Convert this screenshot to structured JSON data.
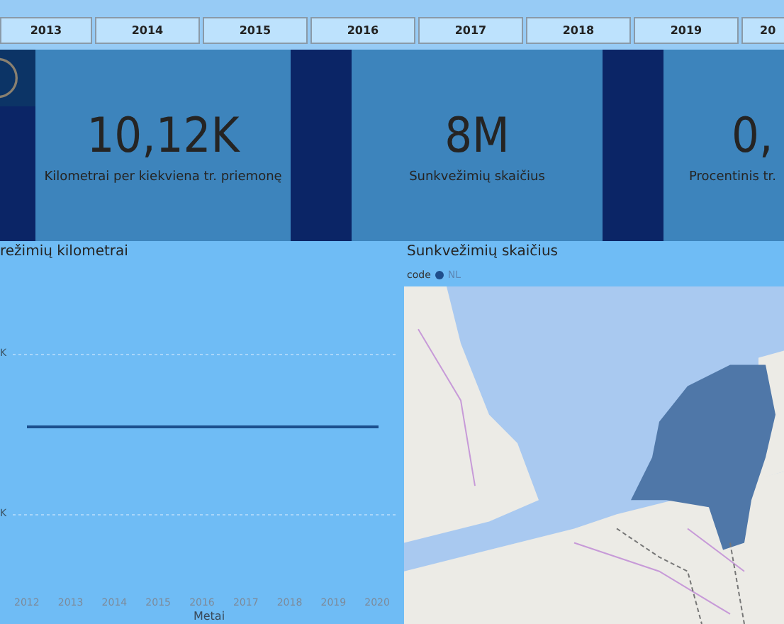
{
  "year_slicer": [
    {
      "label": "2013",
      "selected": false
    },
    {
      "label": "2014",
      "selected": false
    },
    {
      "label": "2015",
      "selected": false
    },
    {
      "label": "2016",
      "selected": false
    },
    {
      "label": "2017",
      "selected": false
    },
    {
      "label": "2018",
      "selected": false
    },
    {
      "label": "2019",
      "selected": false
    },
    {
      "label": "20",
      "selected": false
    }
  ],
  "cards": [
    {
      "value": "10,12K",
      "label": "Kilometrai per kiekviena tr. priemonę"
    },
    {
      "value": "8M",
      "label": "Sunkvežimių skaičius"
    },
    {
      "value": "0,",
      "label": "Procentinis tr."
    }
  ],
  "line_chart": {
    "title": "režimių kilometrai",
    "y_ticks": [
      "K",
      "K"
    ],
    "x_ticks": [
      "2012",
      "2013",
      "2014",
      "2015",
      "2016",
      "2017",
      "2018",
      "2019",
      "2020"
    ],
    "x_title": "Metai"
  },
  "map_panel": {
    "title": "Sunkvežimių skaičius",
    "legend_title": "code",
    "legend_items": [
      {
        "label": "NL",
        "color": "#1f4e8c"
      }
    ]
  }
}
